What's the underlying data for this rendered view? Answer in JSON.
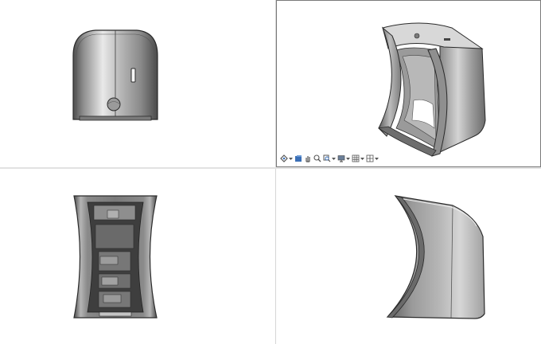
{
  "viewports": [
    {
      "id": "top-left",
      "view": "front"
    },
    {
      "id": "top-right",
      "view": "isometric",
      "active": true
    },
    {
      "id": "bottom-left",
      "view": "bottom"
    },
    {
      "id": "bottom-right",
      "view": "side"
    }
  ],
  "view_toolbar": {
    "tools": [
      {
        "name": "view-orientation-icon"
      },
      {
        "name": "display-style-icon"
      },
      {
        "name": "pan-icon"
      },
      {
        "name": "zoom-to-area-icon"
      },
      {
        "name": "zoom-to-fit-icon"
      },
      {
        "name": "display-monitor-icon"
      },
      {
        "name": "section-view-icon"
      },
      {
        "name": "grid-viewports-icon"
      }
    ]
  },
  "colors": {
    "model_light": "#e4e4e4",
    "model_mid": "#a7a7a7",
    "model_dark": "#5a5a5a",
    "edge": "#2b2b2b",
    "active_border": "#7a7a7a",
    "toolbar_blue": "#3b6fb6"
  }
}
